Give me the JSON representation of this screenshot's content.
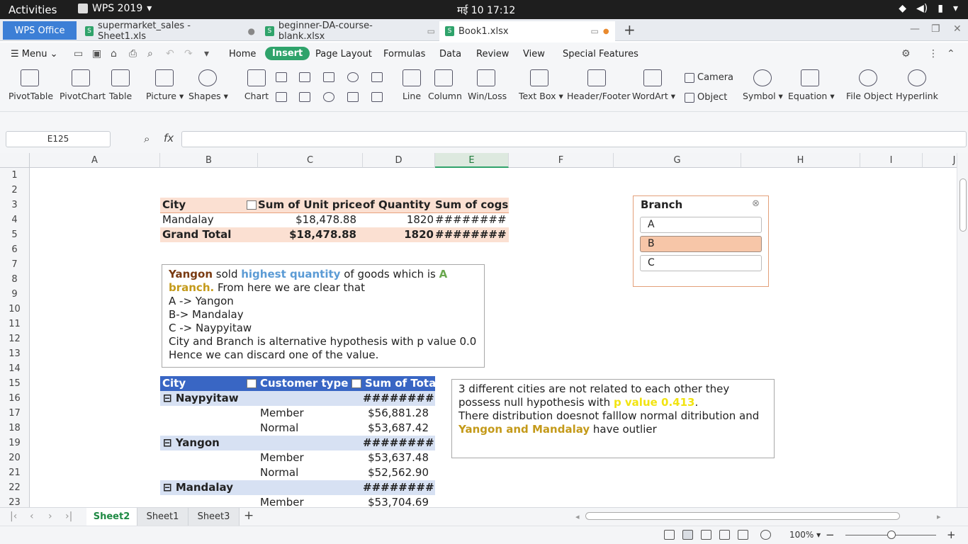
{
  "topbar": {
    "activities": "Activities",
    "app": "WPS 2019",
    "clock": "मई 10  17:12"
  },
  "tabs": {
    "wps": "WPS Office",
    "doc1": "supermarket_sales - Sheet1.xls",
    "doc2": "beginner-DA-course-blank.xlsx",
    "doc3": "Book1.xlsx"
  },
  "menubar": {
    "menu": "Menu",
    "items": [
      "Home",
      "Insert",
      "Page Layout",
      "Formulas",
      "Data",
      "Review",
      "View",
      "Special Features"
    ]
  },
  "toolbar": {
    "pivottable": "PivotTable",
    "pivotchart": "PivotChart",
    "table": "Table",
    "picture": "Picture",
    "shapes": "Shapes",
    "chart": "Chart",
    "line": "Line",
    "column": "Column",
    "winloss": "Win/Loss",
    "textbox": "Text Box",
    "headerfooter": "Header/Footer",
    "wordart": "WordArt",
    "camera": "Camera",
    "object": "Object",
    "symbol": "Symbol",
    "equation": "Equation",
    "fileobject": "File Object",
    "hyperlink": "Hyperlink"
  },
  "formula": {
    "namebox": "E125",
    "fx": "fx",
    "value": ""
  },
  "columns": [
    "A",
    "B",
    "C",
    "D",
    "E",
    "F",
    "G",
    "H",
    "I",
    "J"
  ],
  "rows": [
    "1",
    "2",
    "3",
    "4",
    "5",
    "6",
    "7",
    "8",
    "9",
    "10",
    "11",
    "12",
    "13",
    "14",
    "15",
    "16",
    "17",
    "18",
    "19",
    "20",
    "21",
    "22",
    "23"
  ],
  "pivot1": {
    "headers": [
      "City",
      "Sum of Unit price",
      "of Quantity",
      "Sum of cogs"
    ],
    "row1": [
      "Mandalay",
      "$18,478.88",
      "1820",
      "########"
    ],
    "total": [
      "Grand Total",
      "$18,478.88",
      "1820",
      "########"
    ]
  },
  "note1": {
    "w1": "Yangon",
    "w2": " sold ",
    "w3": "highest quantity",
    "w4": " of goods which is ",
    "w5": "A",
    "w6": "branch.",
    "w7": " From here we are clear that",
    "l3": "A -> Yangon",
    "l4": "B-> Mandalay",
    "l5": "C -> Naypyitaw",
    "l6": "City and Branch is alternative hypothesis with p value 0.0",
    "l7": "Hence we can discard one of the value."
  },
  "slicer": {
    "title": "Branch",
    "options": [
      "A",
      "B",
      "C"
    ],
    "selected": "B"
  },
  "pivot2": {
    "headers": [
      "City",
      "Customer type",
      "Sum of Tota"
    ],
    "groups": [
      {
        "city": "Naypyitaw",
        "total": "########",
        "rows": [
          [
            "Member",
            "$56,881.28"
          ],
          [
            "Normal",
            "$53,687.42"
          ]
        ]
      },
      {
        "city": "Yangon",
        "total": "########",
        "rows": [
          [
            "Member",
            "$53,637.48"
          ],
          [
            "Normal",
            "$52,562.90"
          ]
        ]
      },
      {
        "city": "Mandalay",
        "total": "########",
        "rows": [
          [
            "Member",
            "$53,704.69"
          ]
        ]
      }
    ]
  },
  "note2": {
    "l1": "3 different cities are not related to each other they",
    "l2a": "possess null hypothesis with ",
    "l2b": "p value 0.413",
    "l2c": ".",
    "l3": "There distribution doesnot falllow normal ditribution and",
    "l4a": "Yangon and Mandalay",
    "l4b": " have outlier"
  },
  "sheets": [
    "Sheet2",
    "Sheet1",
    "Sheet3"
  ],
  "status": {
    "zoom": "100%"
  },
  "colors": {
    "accent": "#2fa36b",
    "tab_blue": "#3c7fd6",
    "yangon": "#7a3b12",
    "highest": "#5b9bd5",
    "branch": "#c49a1a",
    "pvalue": "#f2e411"
  }
}
